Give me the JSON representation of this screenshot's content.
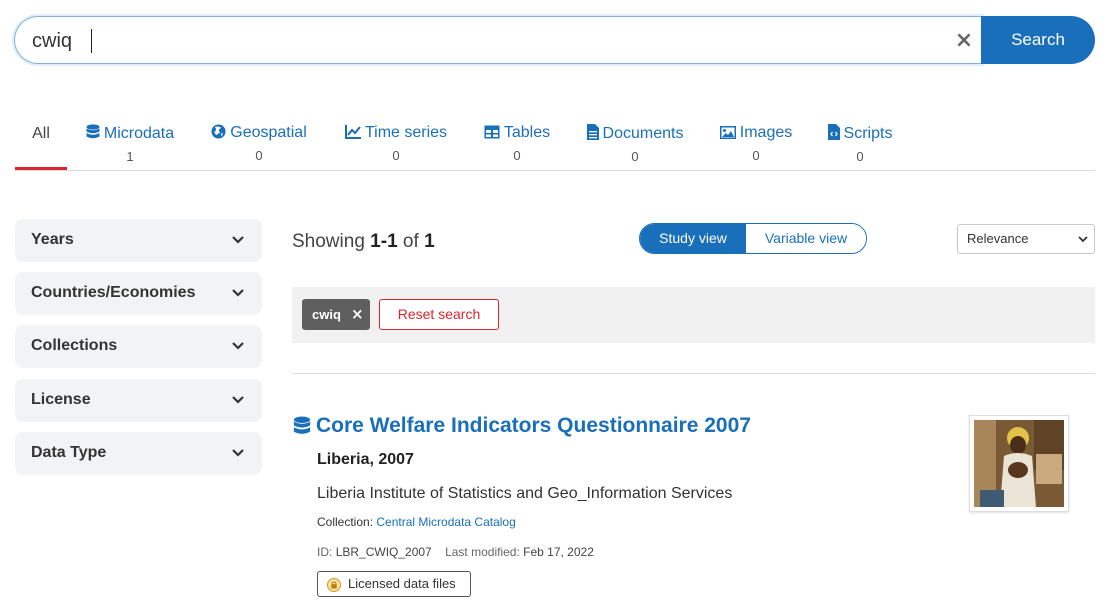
{
  "search": {
    "query": "cwiq",
    "clear_symbol": "×",
    "button_label": "Search"
  },
  "tabs": [
    {
      "label": "All",
      "count": "",
      "icon": "none"
    },
    {
      "label": "Microdata",
      "count": "1",
      "icon": "database-icon"
    },
    {
      "label": "Geospatial",
      "count": "0",
      "icon": "globe-icon"
    },
    {
      "label": "Time series",
      "count": "0",
      "icon": "line-chart-icon"
    },
    {
      "label": "Tables",
      "count": "0",
      "icon": "table-icon"
    },
    {
      "label": "Documents",
      "count": "0",
      "icon": "document-icon"
    },
    {
      "label": "Images",
      "count": "0",
      "icon": "image-icon"
    },
    {
      "label": "Scripts",
      "count": "0",
      "icon": "script-file-icon"
    }
  ],
  "facets": [
    "Years",
    "Countries/Economies",
    "Collections",
    "License",
    "Data Type"
  ],
  "results_header": {
    "showing_prefix": "Showing",
    "range": "1-1",
    "of_word": "of",
    "total": "1",
    "study_view_label": "Study view",
    "variable_view_label": "Variable view",
    "sort_selected": "Relevance"
  },
  "filters": {
    "active_chip": "cwiq",
    "chip_remove_symbol": "×",
    "reset_label": "Reset search"
  },
  "result": {
    "title": "Core Welfare Indicators Questionnaire 2007",
    "country_year": "Liberia, 2007",
    "producer": "Liberia Institute of Statistics and Geo_Information Services",
    "collection_label": "Collection:",
    "collection_value": "Central Microdata Catalog",
    "id_label": "ID:",
    "id_value": "LBR_CWIQ_2007",
    "modified_label": "Last modified:",
    "modified_value": "Feb 17, 2022",
    "license_label": "Licensed data files"
  },
  "colors": {
    "accent": "#1a6fbb",
    "active_tab_underline": "#d9262e",
    "reset_red": "#d9262e"
  }
}
